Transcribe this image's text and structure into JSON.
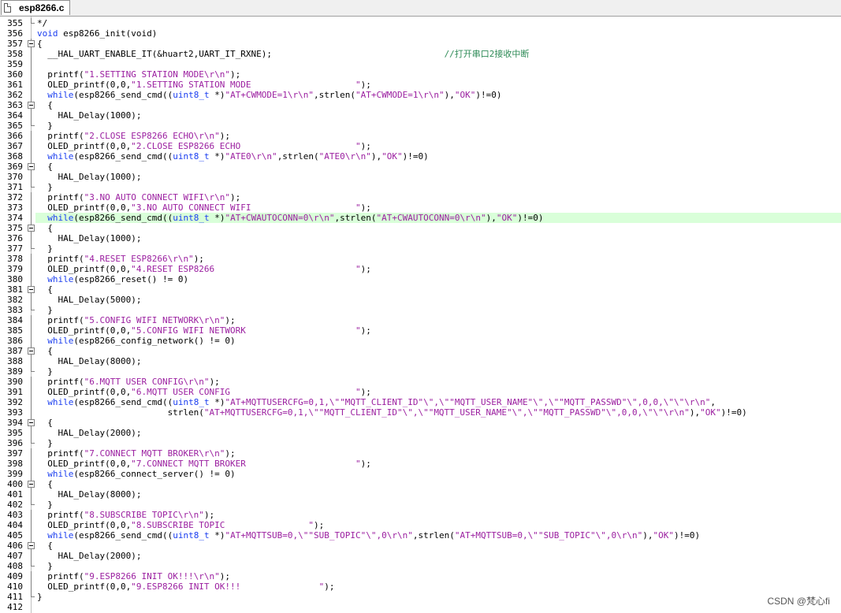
{
  "tab": {
    "label": "esp8266.c",
    "icon": "file-icon"
  },
  "highlight_line": 374,
  "lines": [
    {
      "n": "355",
      "fold": "end",
      "tokens": [
        [
          "p",
          "*/"
        ]
      ]
    },
    {
      "n": "356",
      "fold": "none",
      "tokens": [
        [
          "k",
          "void"
        ],
        [
          "p",
          " esp8266_init(void)"
        ]
      ]
    },
    {
      "n": "357",
      "fold": "box",
      "tokens": [
        [
          "p",
          "{"
        ]
      ]
    },
    {
      "n": "358",
      "fold": "line",
      "tokens": [
        [
          "p",
          "  __HAL_UART_ENABLE_IT(&huart2,UART_IT_RXNE);                                 "
        ],
        [
          "c",
          "//打开串口2接收中断"
        ]
      ]
    },
    {
      "n": "359",
      "fold": "line",
      "tokens": [
        [
          "p",
          ""
        ]
      ]
    },
    {
      "n": "360",
      "fold": "line",
      "tokens": [
        [
          "p",
          "  printf("
        ],
        [
          "s",
          "\"1.SETTING STATION MODE\\r\\n\""
        ],
        [
          "p",
          ");"
        ]
      ]
    },
    {
      "n": "361",
      "fold": "line",
      "tokens": [
        [
          "p",
          "  OLED_printf(0,0,"
        ],
        [
          "s",
          "\"1.SETTING STATION MODE                    \""
        ],
        [
          "p",
          ");"
        ]
      ]
    },
    {
      "n": "362",
      "fold": "line",
      "tokens": [
        [
          "p",
          "  "
        ],
        [
          "k",
          "while"
        ],
        [
          "p",
          "(esp8266_send_cmd(("
        ],
        [
          "k",
          "uint8_t"
        ],
        [
          "p",
          " *)"
        ],
        [
          "s",
          "\"AT+CWMODE=1\\r\\n\""
        ],
        [
          "p",
          ",strlen("
        ],
        [
          "s",
          "\"AT+CWMODE=1\\r\\n\""
        ],
        [
          "p",
          "),"
        ],
        [
          "s",
          "\"OK\""
        ],
        [
          "p",
          ")!=0)"
        ]
      ]
    },
    {
      "n": "363",
      "fold": "box",
      "tokens": [
        [
          "p",
          "  {"
        ]
      ]
    },
    {
      "n": "364",
      "fold": "line",
      "tokens": [
        [
          "p",
          "    HAL_Delay(1000);"
        ]
      ]
    },
    {
      "n": "365",
      "fold": "end",
      "tokens": [
        [
          "p",
          "  }"
        ]
      ]
    },
    {
      "n": "366",
      "fold": "line",
      "tokens": [
        [
          "p",
          "  printf("
        ],
        [
          "s",
          "\"2.CLOSE ESP8266 ECHO\\r\\n\""
        ],
        [
          "p",
          ");"
        ]
      ]
    },
    {
      "n": "367",
      "fold": "line",
      "tokens": [
        [
          "p",
          "  OLED_printf(0,0,"
        ],
        [
          "s",
          "\"2.CLOSE ESP8266 ECHO                      \""
        ],
        [
          "p",
          ");"
        ]
      ]
    },
    {
      "n": "368",
      "fold": "line",
      "tokens": [
        [
          "p",
          "  "
        ],
        [
          "k",
          "while"
        ],
        [
          "p",
          "(esp8266_send_cmd(("
        ],
        [
          "k",
          "uint8_t"
        ],
        [
          "p",
          " *)"
        ],
        [
          "s",
          "\"ATE0\\r\\n\""
        ],
        [
          "p",
          ",strlen("
        ],
        [
          "s",
          "\"ATE0\\r\\n\""
        ],
        [
          "p",
          "),"
        ],
        [
          "s",
          "\"OK\""
        ],
        [
          "p",
          ")!=0)"
        ]
      ]
    },
    {
      "n": "369",
      "fold": "box",
      "tokens": [
        [
          "p",
          "  {"
        ]
      ]
    },
    {
      "n": "370",
      "fold": "line",
      "tokens": [
        [
          "p",
          "    HAL_Delay(1000);"
        ]
      ]
    },
    {
      "n": "371",
      "fold": "end",
      "tokens": [
        [
          "p",
          "  }"
        ]
      ]
    },
    {
      "n": "372",
      "fold": "line",
      "tokens": [
        [
          "p",
          "  printf("
        ],
        [
          "s",
          "\"3.NO AUTO CONNECT WIFI\\r\\n\""
        ],
        [
          "p",
          ");"
        ]
      ]
    },
    {
      "n": "373",
      "fold": "line",
      "tokens": [
        [
          "p",
          "  OLED_printf(0,0,"
        ],
        [
          "s",
          "\"3.NO AUTO CONNECT WIFI                    \""
        ],
        [
          "p",
          ");"
        ]
      ]
    },
    {
      "n": "374",
      "fold": "line",
      "tokens": [
        [
          "p",
          "  "
        ],
        [
          "k",
          "while"
        ],
        [
          "p",
          "(esp8266_send_cmd(("
        ],
        [
          "k",
          "uint8_t"
        ],
        [
          "p",
          " *)"
        ],
        [
          "s",
          "\"AT+CWAUTOCONN=0\\r\\n\""
        ],
        [
          "p",
          ",strlen("
        ],
        [
          "s",
          "\"AT+CWAUTOCONN=0\\r\\n\""
        ],
        [
          "p",
          "),"
        ],
        [
          "s",
          "\"OK\""
        ],
        [
          "p",
          ")!=0)"
        ]
      ]
    },
    {
      "n": "375",
      "fold": "box",
      "tokens": [
        [
          "p",
          "  {"
        ]
      ]
    },
    {
      "n": "376",
      "fold": "line",
      "tokens": [
        [
          "p",
          "    HAL_Delay(1000);"
        ]
      ]
    },
    {
      "n": "377",
      "fold": "end",
      "tokens": [
        [
          "p",
          "  }"
        ]
      ]
    },
    {
      "n": "378",
      "fold": "line",
      "tokens": [
        [
          "p",
          "  printf("
        ],
        [
          "s",
          "\"4.RESET ESP8266\\r\\n\""
        ],
        [
          "p",
          ");"
        ]
      ]
    },
    {
      "n": "379",
      "fold": "line",
      "tokens": [
        [
          "p",
          "  OLED_printf(0,0,"
        ],
        [
          "s",
          "\"4.RESET ESP8266                           \""
        ],
        [
          "p",
          ");"
        ]
      ]
    },
    {
      "n": "380",
      "fold": "line",
      "tokens": [
        [
          "p",
          "  "
        ],
        [
          "k",
          "while"
        ],
        [
          "p",
          "(esp8266_reset() != 0)"
        ]
      ]
    },
    {
      "n": "381",
      "fold": "box",
      "tokens": [
        [
          "p",
          "  {"
        ]
      ]
    },
    {
      "n": "382",
      "fold": "line",
      "tokens": [
        [
          "p",
          "    HAL_Delay(5000);"
        ]
      ]
    },
    {
      "n": "383",
      "fold": "end",
      "tokens": [
        [
          "p",
          "  }"
        ]
      ]
    },
    {
      "n": "384",
      "fold": "line",
      "tokens": [
        [
          "p",
          "  printf("
        ],
        [
          "s",
          "\"5.CONFIG WIFI NETWORK\\r\\n\""
        ],
        [
          "p",
          ");"
        ]
      ]
    },
    {
      "n": "385",
      "fold": "line",
      "tokens": [
        [
          "p",
          "  OLED_printf(0,0,"
        ],
        [
          "s",
          "\"5.CONFIG WIFI NETWORK                     \""
        ],
        [
          "p",
          ");"
        ]
      ]
    },
    {
      "n": "386",
      "fold": "line",
      "tokens": [
        [
          "p",
          "  "
        ],
        [
          "k",
          "while"
        ],
        [
          "p",
          "(esp8266_config_network() != 0)"
        ]
      ]
    },
    {
      "n": "387",
      "fold": "box",
      "tokens": [
        [
          "p",
          "  {"
        ]
      ]
    },
    {
      "n": "388",
      "fold": "line",
      "tokens": [
        [
          "p",
          "    HAL_Delay(8000);"
        ]
      ]
    },
    {
      "n": "389",
      "fold": "end",
      "tokens": [
        [
          "p",
          "  }"
        ]
      ]
    },
    {
      "n": "390",
      "fold": "line",
      "tokens": [
        [
          "p",
          "  printf("
        ],
        [
          "s",
          "\"6.MQTT USER CONFIG\\r\\n\""
        ],
        [
          "p",
          ");"
        ]
      ]
    },
    {
      "n": "391",
      "fold": "line",
      "tokens": [
        [
          "p",
          "  OLED_printf(0,0,"
        ],
        [
          "s",
          "\"6.MQTT USER CONFIG                        \""
        ],
        [
          "p",
          ");"
        ]
      ]
    },
    {
      "n": "392",
      "fold": "line",
      "tokens": [
        [
          "p",
          "  "
        ],
        [
          "k",
          "while"
        ],
        [
          "p",
          "(esp8266_send_cmd(("
        ],
        [
          "k",
          "uint8_t"
        ],
        [
          "p",
          " *)"
        ],
        [
          "s",
          "\"AT+MQTTUSERCFG=0,1,\\\"\"MQTT_CLIENT_ID\"\\\",\\\"\"MQTT_USER_NAME\"\\\",\\\"\"MQTT_PASSWD\"\\\",0,0,\\\"\\\"\\r\\n\""
        ],
        [
          "p",
          ","
        ]
      ]
    },
    {
      "n": "393",
      "fold": "line",
      "tokens": [
        [
          "p",
          "                         strlen("
        ],
        [
          "s",
          "\"AT+MQTTUSERCFG=0,1,\\\"\"MQTT_CLIENT_ID\"\\\",\\\"\"MQTT_USER_NAME\"\\\",\\\"\"MQTT_PASSWD\"\\\",0,0,\\\"\\\"\\r\\n\""
        ],
        [
          "p",
          "),"
        ],
        [
          "s",
          "\"OK\""
        ],
        [
          "p",
          ")!=0)"
        ]
      ]
    },
    {
      "n": "394",
      "fold": "box",
      "tokens": [
        [
          "p",
          "  {"
        ]
      ]
    },
    {
      "n": "395",
      "fold": "line",
      "tokens": [
        [
          "p",
          "    HAL_Delay(2000);"
        ]
      ]
    },
    {
      "n": "396",
      "fold": "end",
      "tokens": [
        [
          "p",
          "  }"
        ]
      ]
    },
    {
      "n": "397",
      "fold": "line",
      "tokens": [
        [
          "p",
          "  printf("
        ],
        [
          "s",
          "\"7.CONNECT MQTT BROKER\\r\\n\""
        ],
        [
          "p",
          ");"
        ]
      ]
    },
    {
      "n": "398",
      "fold": "line",
      "tokens": [
        [
          "p",
          "  OLED_printf(0,0,"
        ],
        [
          "s",
          "\"7.CONNECT MQTT BROKER                     \""
        ],
        [
          "p",
          ");"
        ]
      ]
    },
    {
      "n": "399",
      "fold": "line",
      "tokens": [
        [
          "p",
          "  "
        ],
        [
          "k",
          "while"
        ],
        [
          "p",
          "(esp8266_connect_server() != 0)"
        ]
      ]
    },
    {
      "n": "400",
      "fold": "box",
      "tokens": [
        [
          "p",
          "  {"
        ]
      ]
    },
    {
      "n": "401",
      "fold": "line",
      "tokens": [
        [
          "p",
          "    HAL_Delay(8000);"
        ]
      ]
    },
    {
      "n": "402",
      "fold": "end",
      "tokens": [
        [
          "p",
          "  }"
        ]
      ]
    },
    {
      "n": "403",
      "fold": "line",
      "tokens": [
        [
          "p",
          "  printf("
        ],
        [
          "s",
          "\"8.SUBSCRIBE TOPIC\\r\\n\""
        ],
        [
          "p",
          ");"
        ]
      ]
    },
    {
      "n": "404",
      "fold": "line",
      "tokens": [
        [
          "p",
          "  OLED_printf(0,0,"
        ],
        [
          "s",
          "\"8.SUBSCRIBE TOPIC                \""
        ],
        [
          "p",
          ");"
        ]
      ]
    },
    {
      "n": "405",
      "fold": "line",
      "tokens": [
        [
          "p",
          "  "
        ],
        [
          "k",
          "while"
        ],
        [
          "p",
          "(esp8266_send_cmd(("
        ],
        [
          "k",
          "uint8_t"
        ],
        [
          "p",
          " *)"
        ],
        [
          "s",
          "\"AT+MQTTSUB=0,\\\"\"SUB_TOPIC\"\\\",0\\r\\n\""
        ],
        [
          "p",
          ",strlen("
        ],
        [
          "s",
          "\"AT+MQTTSUB=0,\\\"\"SUB_TOPIC\"\\\",0\\r\\n\""
        ],
        [
          "p",
          "),"
        ],
        [
          "s",
          "\"OK\""
        ],
        [
          "p",
          ")!=0)"
        ]
      ]
    },
    {
      "n": "406",
      "fold": "box",
      "tokens": [
        [
          "p",
          "  {"
        ]
      ]
    },
    {
      "n": "407",
      "fold": "line",
      "tokens": [
        [
          "p",
          "    HAL_Delay(2000);"
        ]
      ]
    },
    {
      "n": "408",
      "fold": "end",
      "tokens": [
        [
          "p",
          "  }"
        ]
      ]
    },
    {
      "n": "409",
      "fold": "line",
      "tokens": [
        [
          "p",
          "  printf("
        ],
        [
          "s",
          "\"9.ESP8266 INIT OK!!!\\r\\n\""
        ],
        [
          "p",
          ");"
        ]
      ]
    },
    {
      "n": "410",
      "fold": "line",
      "tokens": [
        [
          "p",
          "  OLED_printf(0,0,"
        ],
        [
          "s",
          "\"9.ESP8266 INIT OK!!!               \""
        ],
        [
          "p",
          ");"
        ]
      ]
    },
    {
      "n": "411",
      "fold": "end",
      "tokens": [
        [
          "p",
          "}"
        ]
      ]
    },
    {
      "n": "412",
      "fold": "none",
      "tokens": [
        [
          "p",
          ""
        ]
      ]
    }
  ],
  "watermark": "CSDN @梵心ﬁ"
}
